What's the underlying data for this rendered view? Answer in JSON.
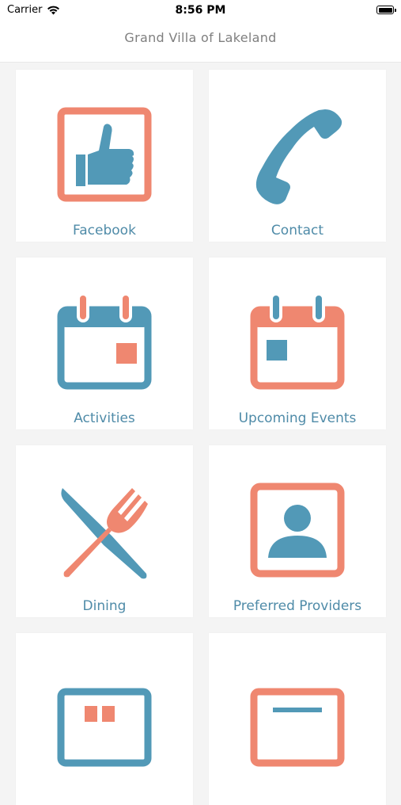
{
  "status_bar": {
    "carrier": "Carrier",
    "time": "8:56 PM"
  },
  "nav": {
    "title": "Grand Villa of Lakeland"
  },
  "colors": {
    "teal": "#5299b7",
    "coral": "#ef8770",
    "label": "#4f8ba8"
  },
  "tiles": [
    {
      "label": "Facebook",
      "icon": "thumbs-up-icon"
    },
    {
      "label": "Contact",
      "icon": "phone-icon"
    },
    {
      "label": "Activities",
      "icon": "calendar-icon"
    },
    {
      "label": "Upcoming Events",
      "icon": "calendar-icon"
    },
    {
      "label": "Dining",
      "icon": "fork-knife-icon"
    },
    {
      "label": "Preferred Providers",
      "icon": "user-icon"
    },
    {
      "label": "",
      "icon": "menu-icon"
    },
    {
      "label": "",
      "icon": "grid-icon"
    }
  ]
}
